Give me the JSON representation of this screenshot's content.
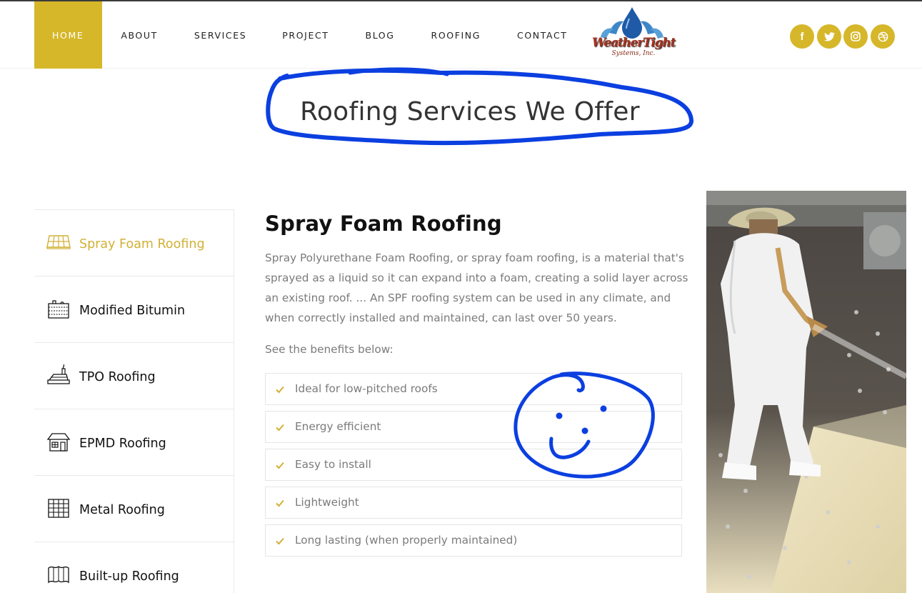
{
  "nav": {
    "items": [
      {
        "label": "HOME",
        "active": true
      },
      {
        "label": "ABOUT"
      },
      {
        "label": "SERVICES"
      },
      {
        "label": "PROJECT"
      },
      {
        "label": "BLOG"
      },
      {
        "label": "ROOFING"
      },
      {
        "label": "CONTACT"
      }
    ]
  },
  "logo": {
    "word": "WeatherTight",
    "sub": "Systems, Inc."
  },
  "social": [
    {
      "icon": "facebook-icon"
    },
    {
      "icon": "twitter-icon"
    },
    {
      "icon": "instagram-icon"
    },
    {
      "icon": "dribbble-icon"
    }
  ],
  "page_title": "Roofing Services We Offer",
  "sidebar": {
    "items": [
      {
        "label": "Spray Foam Roofing",
        "icon": "solar-panel-icon",
        "active": true
      },
      {
        "label": "Modified Bitumin",
        "icon": "roof-layers-icon"
      },
      {
        "label": "TPO Roofing",
        "icon": "tpo-roof-icon"
      },
      {
        "label": "EPMD Roofing",
        "icon": "house-icon"
      },
      {
        "label": "Metal Roofing",
        "icon": "metal-roof-icon"
      },
      {
        "label": "Built-up Roofing",
        "icon": "built-up-roof-icon"
      }
    ]
  },
  "content": {
    "title": "Spray Foam Roofing",
    "description": "Spray Polyurethane Foam Roofing, or spray foam roofing, is a material that's sprayed as a liquid so it can expand into a foam, creating a solid layer across an existing roof. ... An SPF roofing system can be used in any climate, and when correctly installed and maintained, can last over 50 years.",
    "benefits_intro": "See the benefits below:",
    "benefits": [
      "Ideal for low-pitched roofs",
      "Energy efficient",
      "Easy to install",
      "Lightweight",
      "Long lasting (when properly maintained)"
    ]
  },
  "colors": {
    "accent": "#d6b72a",
    "annotation": "#0b3fe0",
    "text_muted": "#7b7b7b"
  }
}
